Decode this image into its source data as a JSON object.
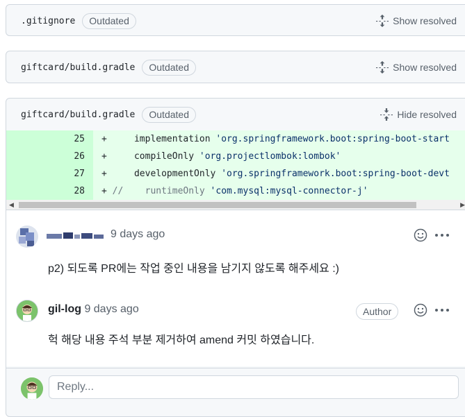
{
  "files": [
    {
      "name": ".gitignore",
      "badge": "Outdated",
      "toggle": "Show resolved"
    },
    {
      "name": "giftcard/build.gradle",
      "badge": "Outdated",
      "toggle": "Show resolved"
    },
    {
      "name": "giftcard/build.gradle",
      "badge": "Outdated",
      "toggle": "Hide resolved"
    }
  ],
  "diff_lines": [
    {
      "num": "25",
      "sign": "+",
      "code_pre": "    implementation ",
      "code_str": "'org.springframework.boot:spring-boot-start"
    },
    {
      "num": "26",
      "sign": "+",
      "code_pre": "    compileOnly ",
      "code_str": "'org.projectlombok:lombok'"
    },
    {
      "num": "27",
      "sign": "+",
      "code_pre": "    developmentOnly ",
      "code_str": "'org.springframework.boot:spring-boot-devt"
    },
    {
      "num": "28",
      "sign": "+",
      "code_pre": "//    runtimeOnly ",
      "code_str": "'com.mysql:mysql-connector-j'"
    }
  ],
  "comments": [
    {
      "author": "",
      "time": "9 days ago",
      "body": "p2) 되도록 PR에는 작업 중인 내용을 남기지 않도록 해주세요 :)"
    },
    {
      "author": "gil-log",
      "time": "9 days ago",
      "badge": "Author",
      "body": "헉 해당 내용 주석 부분 제거하여 amend 커밋 하였습니다."
    }
  ],
  "reply": {
    "placeholder": "Reply..."
  },
  "icons": {
    "emoji": "smiley-icon",
    "more": "kebab-horizontal-icon",
    "unfold": "unfold-icon",
    "fold": "fold-icon"
  }
}
